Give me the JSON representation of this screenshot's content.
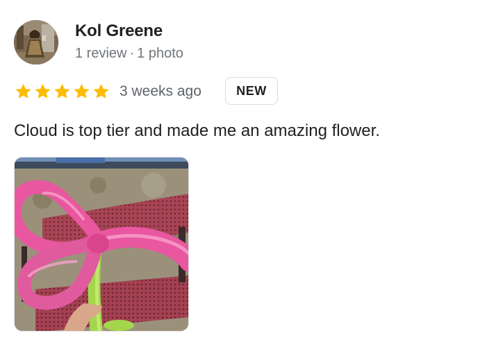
{
  "reviewer": {
    "name": "Kol Greene",
    "review_count": "1 review",
    "separator": "·",
    "photo_count": "1 photo"
  },
  "review": {
    "rating": 5,
    "max_rating": 5,
    "date": "3 weeks ago",
    "badge": "NEW",
    "text": "Cloud is top tier and made me an amazing flower."
  },
  "icons": {
    "star": "star-icon"
  },
  "colors": {
    "star": "#fbbc04",
    "name": "#202124",
    "meta": "#70757a",
    "badge_border": "#dadce0"
  }
}
